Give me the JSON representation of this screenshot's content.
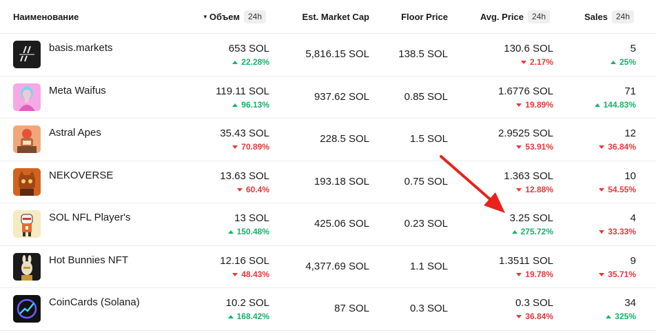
{
  "columns": {
    "name": "Наименование",
    "volume": "Объем",
    "volume_period": "24h",
    "market_cap": "Est. Market Cap",
    "floor": "Floor Price",
    "avg_price": "Avg. Price",
    "avg_price_period": "24h",
    "sales": "Sales",
    "sales_period": "24h"
  },
  "colors": {
    "up": "#17b26a",
    "down": "#e5383b",
    "annotation_arrow": "#e8231b"
  },
  "rows": [
    {
      "name": "basis.markets",
      "logo_icon": "basis-logo-icon",
      "volume": "653 SOL",
      "volume_change": "22.28%",
      "volume_dir": "up",
      "market_cap": "5,816.15 SOL",
      "floor": "138.5 SOL",
      "avg_price": "130.6 SOL",
      "avg_change": "2.17%",
      "avg_dir": "down",
      "sales": "5",
      "sales_change": "25%",
      "sales_dir": "up"
    },
    {
      "name": "Meta Waifus",
      "logo_icon": "meta-waifus-logo-icon",
      "volume": "119.11 SOL",
      "volume_change": "96.13%",
      "volume_dir": "up",
      "market_cap": "937.62 SOL",
      "floor": "0.85 SOL",
      "avg_price": "1.6776 SOL",
      "avg_change": "19.89%",
      "avg_dir": "down",
      "sales": "71",
      "sales_change": "144.83%",
      "sales_dir": "up"
    },
    {
      "name": "Astral Apes",
      "logo_icon": "astral-apes-logo-icon",
      "volume": "35.43 SOL",
      "volume_change": "70.89%",
      "volume_dir": "down",
      "market_cap": "228.5 SOL",
      "floor": "1.5 SOL",
      "avg_price": "2.9525 SOL",
      "avg_change": "53.91%",
      "avg_dir": "down",
      "sales": "12",
      "sales_change": "36.84%",
      "sales_dir": "down"
    },
    {
      "name": "NEKOVERSE",
      "logo_icon": "nekoverse-logo-icon",
      "volume": "13.63 SOL",
      "volume_change": "60.4%",
      "volume_dir": "down",
      "market_cap": "193.18 SOL",
      "floor": "0.75 SOL",
      "avg_price": "1.363 SOL",
      "avg_change": "12.88%",
      "avg_dir": "down",
      "sales": "10",
      "sales_change": "54.55%",
      "sales_dir": "down"
    },
    {
      "name": "SOL NFL Player's",
      "logo_icon": "sol-nfl-logo-icon",
      "volume": "13 SOL",
      "volume_change": "150.48%",
      "volume_dir": "up",
      "market_cap": "425.06 SOL",
      "floor": "0.23 SOL",
      "avg_price": "3.25 SOL",
      "avg_change": "275.72%",
      "avg_dir": "up",
      "sales": "4",
      "sales_change": "33.33%",
      "sales_dir": "down"
    },
    {
      "name": "Hot Bunnies NFT",
      "logo_icon": "hot-bunnies-logo-icon",
      "volume": "12.16 SOL",
      "volume_change": "48.43%",
      "volume_dir": "down",
      "market_cap": "4,377.69 SOL",
      "floor": "1.1 SOL",
      "avg_price": "1.3511 SOL",
      "avg_change": "19.78%",
      "avg_dir": "down",
      "sales": "9",
      "sales_change": "35.71%",
      "sales_dir": "down"
    },
    {
      "name": "CoinCards (Solana)",
      "logo_icon": "coincards-logo-icon",
      "volume": "10.2 SOL",
      "volume_change": "168.42%",
      "volume_dir": "up",
      "market_cap": "87 SOL",
      "floor": "0.3 SOL",
      "avg_price": "0.3 SOL",
      "avg_change": "36.84%",
      "avg_dir": "down",
      "sales": "34",
      "sales_change": "325%",
      "sales_dir": "up"
    }
  ]
}
